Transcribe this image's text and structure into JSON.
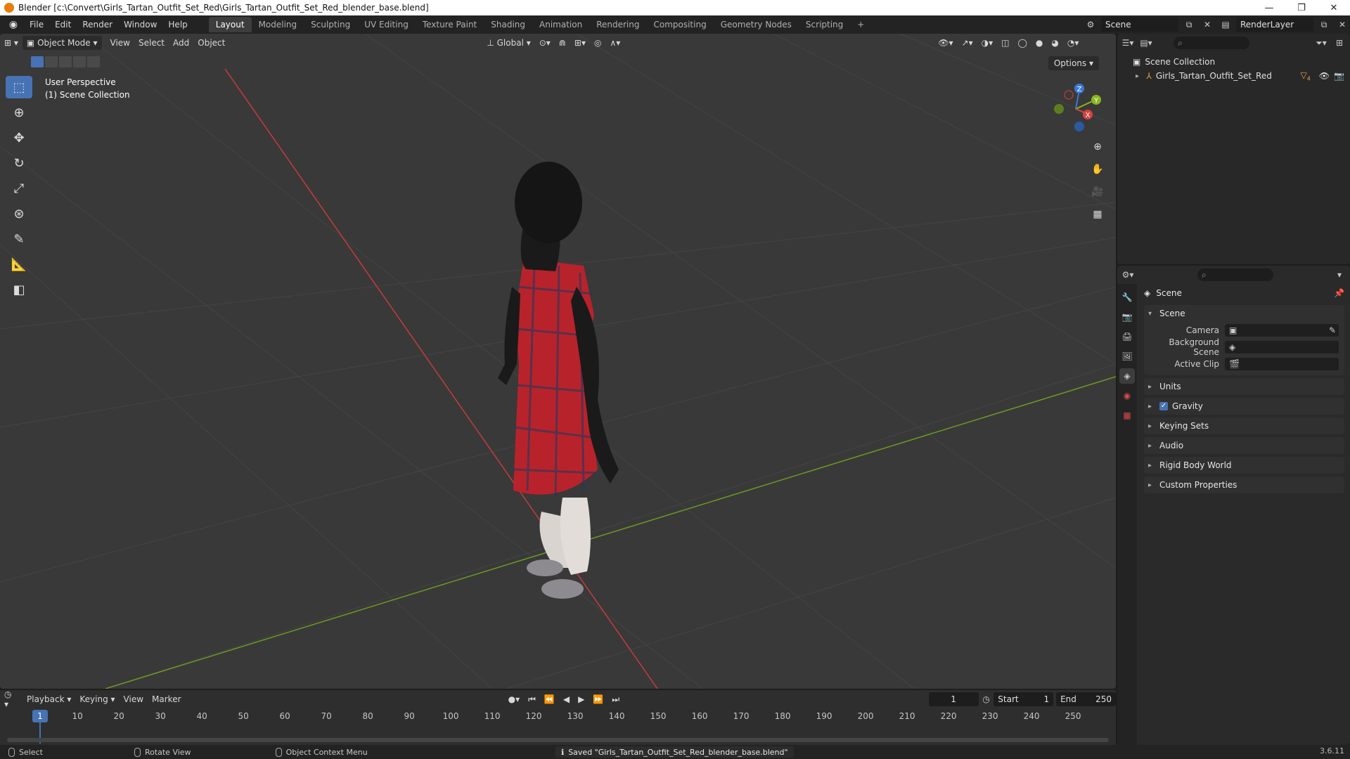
{
  "titlebar": {
    "title": "Blender [c:\\Convert\\Girls_Tartan_Outfit_Set_Red\\Girls_Tartan_Outfit_Set_Red_blender_base.blend]"
  },
  "menu": {
    "items": [
      "File",
      "Edit",
      "Render",
      "Window",
      "Help"
    ]
  },
  "workspaces": {
    "tabs": [
      "Layout",
      "Modeling",
      "Sculpting",
      "UV Editing",
      "Texture Paint",
      "Shading",
      "Animation",
      "Rendering",
      "Compositing",
      "Geometry Nodes",
      "Scripting"
    ],
    "add": "+"
  },
  "topright": {
    "scene": "Scene",
    "view_layer": "RenderLayer"
  },
  "viewport": {
    "mode": "Object Mode",
    "menus": [
      "View",
      "Select",
      "Add",
      "Object"
    ],
    "orientation": "Global",
    "perspective": "User Perspective",
    "collection": "(1) Scene Collection",
    "options": "Options",
    "gizmo": {
      "x": "X",
      "y": "Y",
      "z": "Z"
    }
  },
  "outliner": {
    "root": "Scene Collection",
    "object": "Girls_Tartan_Outfit_Set_Red",
    "modifier_count": "4"
  },
  "properties": {
    "title": "Scene",
    "panel": "Scene",
    "rows": [
      {
        "label": "Camera"
      },
      {
        "label": "Background Scene"
      },
      {
        "label": "Active Clip"
      }
    ],
    "sections": [
      "Units",
      "Gravity",
      "Keying Sets",
      "Audio",
      "Rigid Body World",
      "Custom Properties"
    ]
  },
  "timeline": {
    "menus": [
      "Playback",
      "Keying",
      "View",
      "Marker"
    ],
    "current_frame": "1",
    "start_label": "Start",
    "start": "1",
    "end_label": "End",
    "end": "250",
    "ticks": [
      "10",
      "20",
      "30",
      "40",
      "50",
      "60",
      "70",
      "80",
      "90",
      "100",
      "110",
      "120",
      "130",
      "140",
      "150",
      "160",
      "170",
      "180",
      "190",
      "200",
      "210",
      "220",
      "230",
      "240",
      "250"
    ]
  },
  "status": {
    "select": "Select",
    "rotate": "Rotate View",
    "context": "Object Context Menu",
    "message": "Saved \"Girls_Tartan_Outfit_Set_Red_blender_base.blend\"",
    "version": "3.6.11"
  },
  "colors": {
    "accent": "#4772b3",
    "x_axis": "#c73a3a",
    "y_axis": "#6b9a22",
    "dress_red": "#c0282e"
  }
}
